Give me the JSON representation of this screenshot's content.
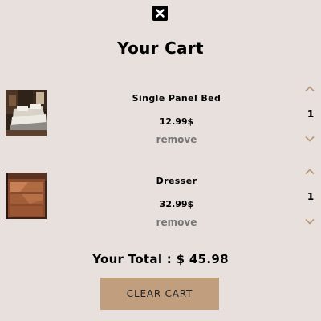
{
  "cart": {
    "title": "Your Cart",
    "total_label": "Your Total : $ 45.98",
    "clear_button_label": "CLEAR CART"
  },
  "items": [
    {
      "name": "Single Panel Bed",
      "price": "12.99$",
      "remove_label": "remove",
      "quantity": "1",
      "image": "bed-photo"
    },
    {
      "name": "Dresser",
      "price": "32.99$",
      "remove_label": "remove",
      "quantity": "1",
      "image": "dresser-photo"
    }
  ],
  "colors": {
    "background": "#e7e0dc",
    "accent": "#c19f7e",
    "chevron": "#b99a7c",
    "remove_text": "#777777"
  },
  "icons": {
    "close": "close-icon",
    "increase": "chevron-up-icon",
    "decrease": "chevron-down-icon"
  }
}
